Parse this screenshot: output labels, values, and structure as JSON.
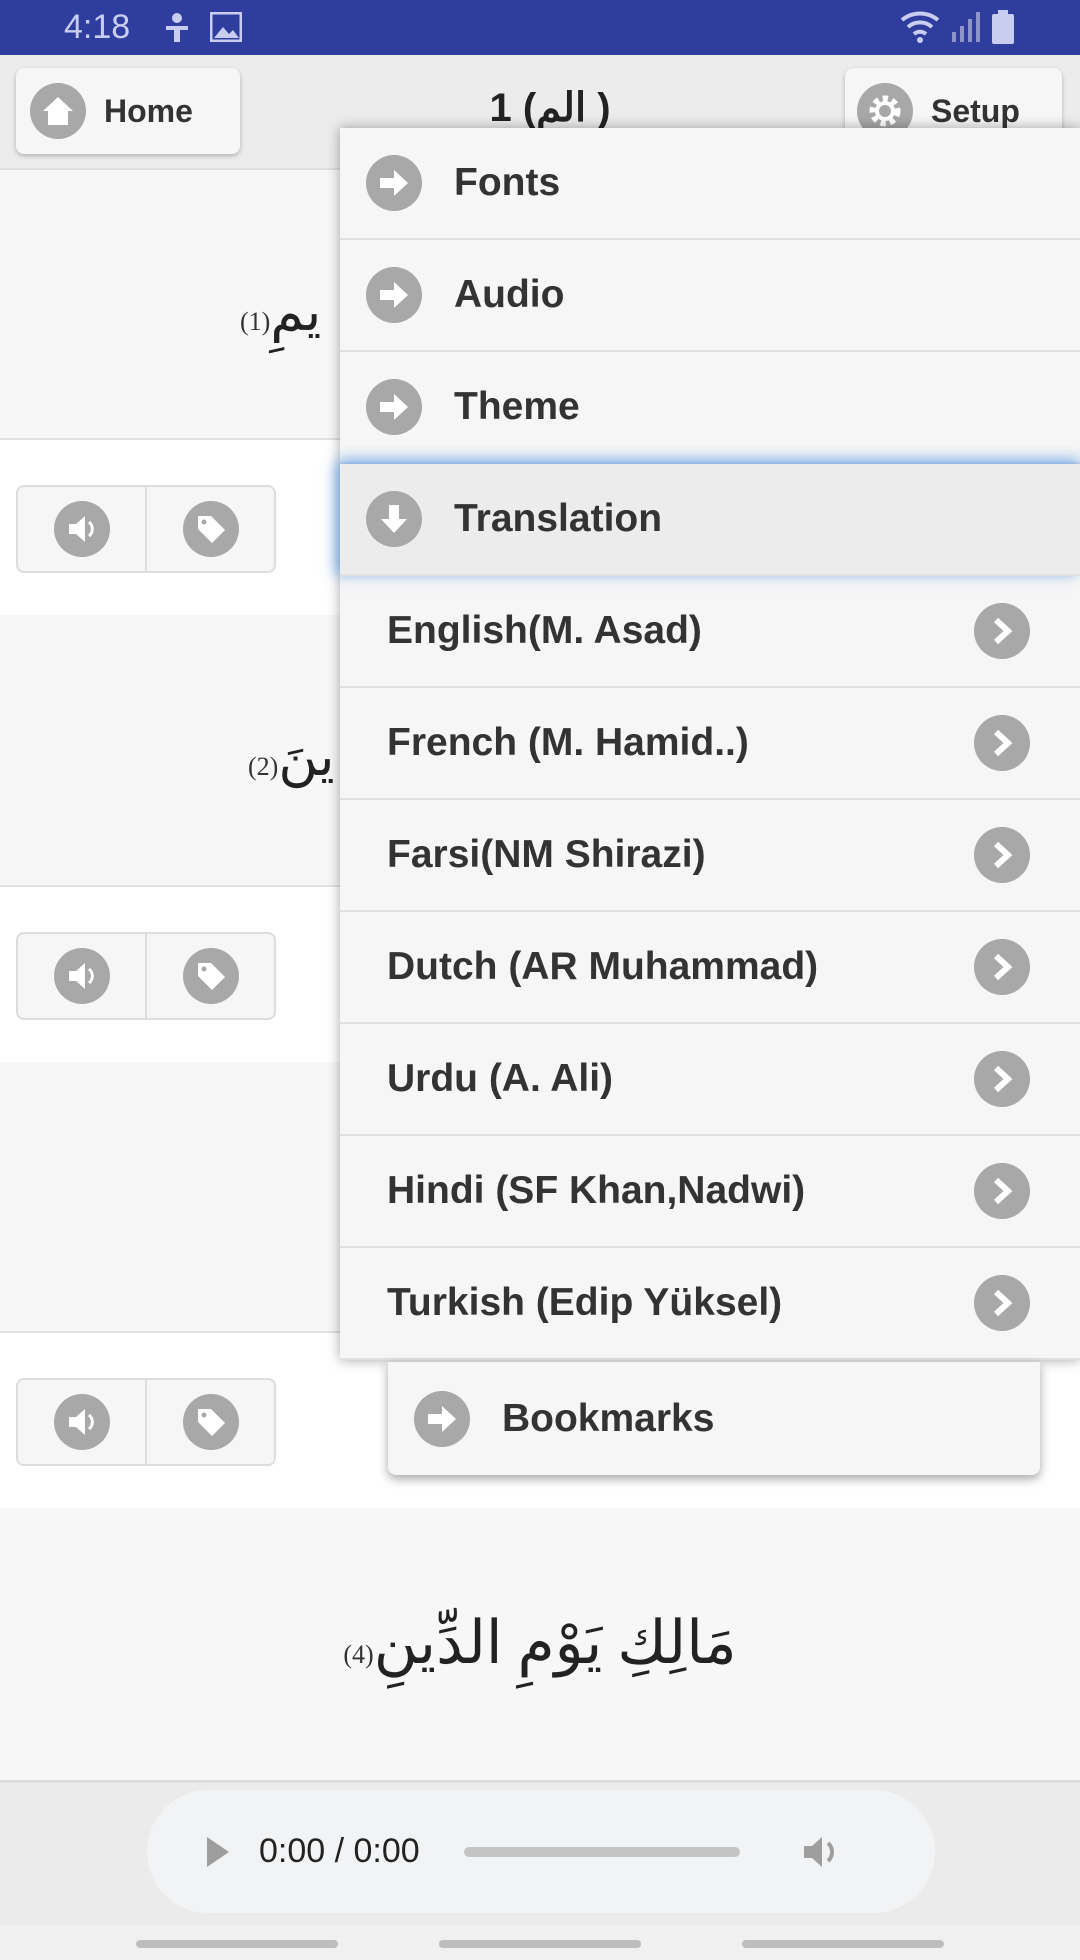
{
  "status_bar": {
    "time": "4:18",
    "icons": [
      "accessibility-icon",
      "image-icon",
      "wifi-icon",
      "signal-icon",
      "battery-icon"
    ]
  },
  "header": {
    "home_label": "Home",
    "title": "1 (الم )",
    "setup_label": "Setup"
  },
  "verses": [
    {
      "text_fragment": "يمِ",
      "number": "(1)"
    },
    {
      "text_fragment": "ينَ",
      "number": "(2)"
    },
    {
      "text": "مَالِكِ يَوْمِ الدِّينِ",
      "number": "(4)"
    }
  ],
  "menu": {
    "items": [
      {
        "label": "Fonts",
        "icon": "arrow-right-circle-icon"
      },
      {
        "label": "Audio",
        "icon": "arrow-right-circle-icon"
      },
      {
        "label": "Theme",
        "icon": "arrow-right-circle-icon"
      },
      {
        "label": "Translation",
        "icon": "arrow-down-circle-icon",
        "expanded": true
      }
    ],
    "translations": [
      "English(M. Asad)",
      "French (M. Hamid..)",
      "Farsi(NM Shirazi)",
      "Dutch (AR Muhammad)",
      "Urdu (A. Ali)",
      "Hindi (SF Khan,Nadwi)",
      "Turkish (Edip Yüksel)"
    ],
    "bookmarks_label": "Bookmarks"
  },
  "player": {
    "time": "0:00 / 0:00",
    "progress": 0
  },
  "colors": {
    "status_bar": "#2f3d9e",
    "icon_gray": "#a8a8a8",
    "highlight_glow": "#64a0e6"
  }
}
